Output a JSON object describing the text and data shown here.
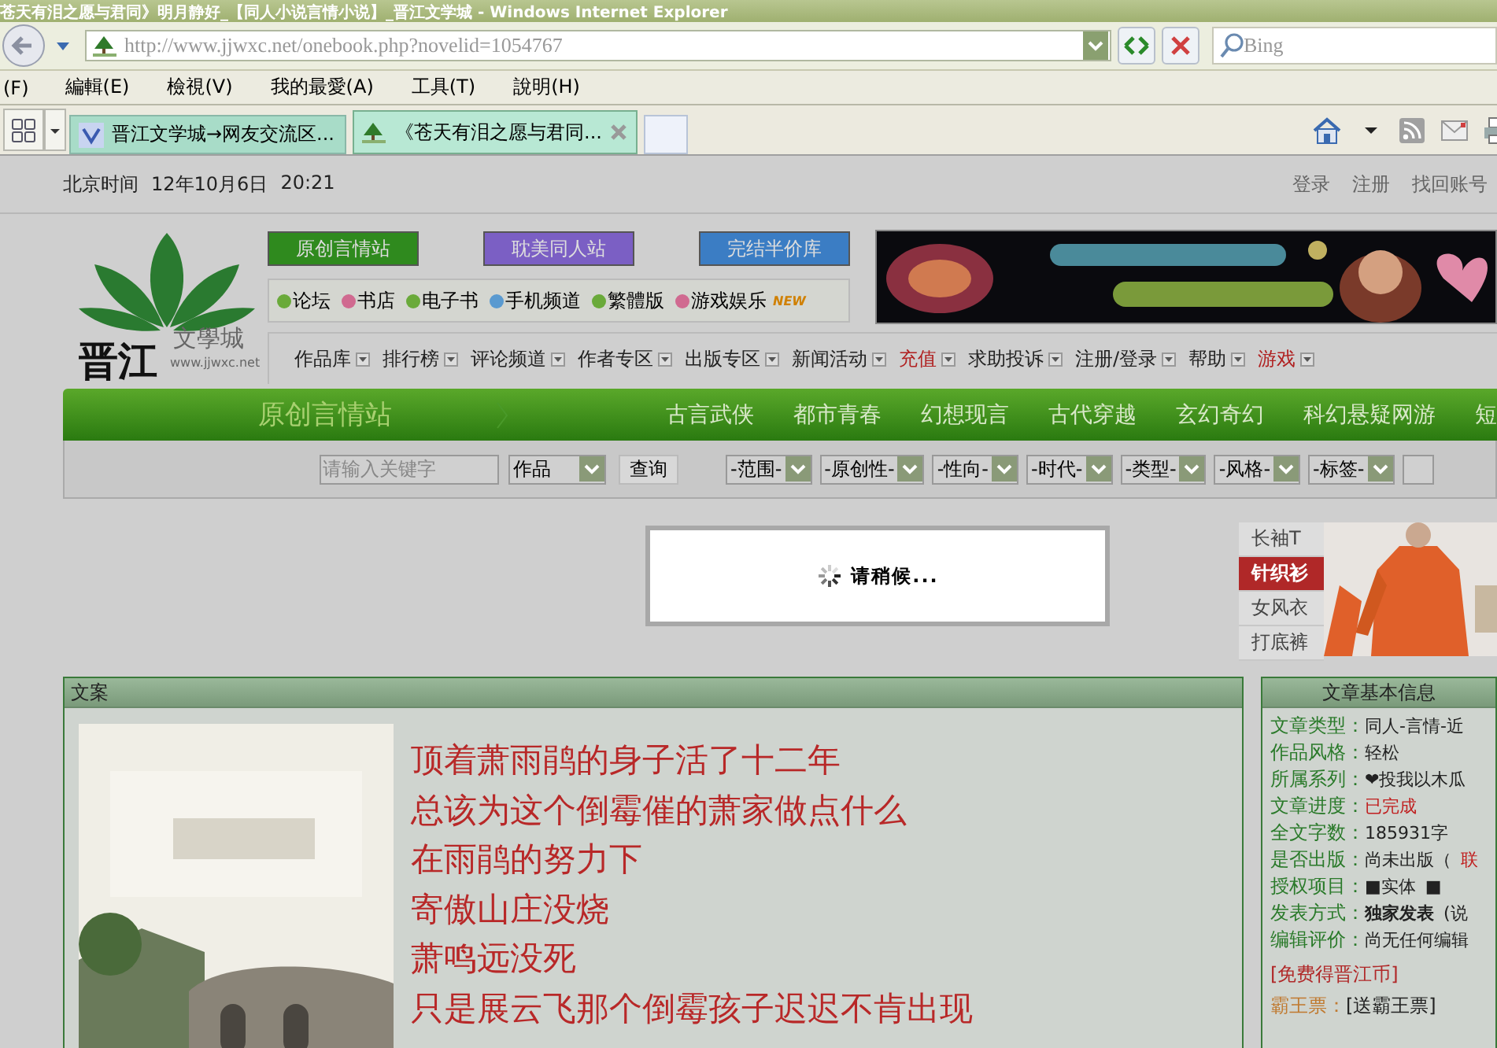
{
  "window": {
    "title": "苍天有泪之愿与君同》明月静好_【同人小说言情小说】_晋江文学城 - Windows Internet Explorer"
  },
  "address_bar": {
    "url": "http://www.jjwxc.net/onebook.php?novelid=1054767"
  },
  "search": {
    "placeholder": "Bing"
  },
  "menu": [
    "(F)",
    "編輯(E)",
    "檢視(V)",
    "我的最愛(A)",
    "工具(T)",
    "說明(H)"
  ],
  "tabs": [
    {
      "label": "晋江文学城→网友交流区...",
      "selected": false
    },
    {
      "label": "《苍天有泪之愿与君同...",
      "selected": true
    }
  ],
  "page": {
    "clock": {
      "label": "北京时间",
      "date": "12年10月6日",
      "time": "20:21"
    },
    "account_links": [
      "登录",
      "注册",
      "找回账号"
    ],
    "logo": {
      "name": "晋江",
      "subtitle": "文學城",
      "url": "www.jjwxc.net"
    },
    "site_buttons": [
      {
        "label": "原创言情站",
        "color": "#2f8a1e"
      },
      {
        "label": "耽美同人站",
        "color": "#7b5fc4"
      },
      {
        "label": "完结半价库",
        "color": "#3b7dc4"
      }
    ],
    "quick_links": [
      {
        "label": "论坛",
        "color": "#6aaa3a"
      },
      {
        "label": "书店",
        "color": "#d06a90"
      },
      {
        "label": "电子书",
        "color": "#6aaa3a"
      },
      {
        "label": "手机频道",
        "color": "#5a9ad0"
      },
      {
        "label": "繁體版",
        "color": "#6aaa3a"
      },
      {
        "label": "游戏娱乐",
        "color": "#d06a90",
        "badge": "NEW"
      }
    ],
    "nav": [
      {
        "label": "作品库",
        "highlight": false
      },
      {
        "label": "排行榜",
        "highlight": false
      },
      {
        "label": "评论频道",
        "highlight": false
      },
      {
        "label": "作者专区",
        "highlight": false
      },
      {
        "label": "出版专区",
        "highlight": false
      },
      {
        "label": "新闻活动",
        "highlight": false
      },
      {
        "label": "充值",
        "highlight": true
      },
      {
        "label": "求助投诉",
        "highlight": false
      },
      {
        "label": "注册/登录",
        "highlight": false
      },
      {
        "label": "帮助",
        "highlight": false
      },
      {
        "label": "游戏",
        "highlight": true
      }
    ],
    "channel": {
      "title": "原创言情站",
      "categories": [
        "古言武侠",
        "都市青春",
        "幻想现言",
        "古代穿越",
        "玄幻奇幻",
        "科幻悬疑网游",
        "短"
      ]
    },
    "filter": {
      "placeholder": "请输入关键字",
      "type": "作品",
      "button": "查询",
      "selects": [
        "-范围-",
        "-原创性-",
        "-性向-",
        "-时代-",
        "-类型-",
        "-风格-",
        "-标签-"
      ]
    },
    "loading": {
      "text": "请稍候..."
    },
    "ad": {
      "tags": [
        {
          "label": "长袖T",
          "selected": false
        },
        {
          "label": "针织衫",
          "selected": true
        },
        {
          "label": "女风衣",
          "selected": false
        },
        {
          "label": "打底裤",
          "selected": false
        }
      ]
    },
    "synopsis": {
      "title": "文案",
      "lines": [
        "顶着萧雨鹃的身子活了十二年",
        "总该为这个倒霉催的萧家做点什么",
        "在雨鹃的努力下",
        "寄傲山庄没烧",
        "萧鸣远没死",
        "只是展云飞那个倒霉孩子迟迟不肯出现"
      ]
    },
    "info": {
      "title": "文章基本信息",
      "rows": [
        {
          "label": "文章类型：",
          "value": "同人-言情-近",
          "alert": false,
          "bold": false
        },
        {
          "label": "作品风格：",
          "value": "轻松",
          "alert": false,
          "bold": false
        },
        {
          "label": "所属系列：",
          "value": "❤投我以木瓜",
          "alert": false,
          "bold": false
        },
        {
          "label": "文章进度：",
          "value": "已完成",
          "alert": true,
          "bold": false
        },
        {
          "label": "全文字数：",
          "value": "185931字",
          "alert": false,
          "bold": false
        },
        {
          "label": "是否出版：",
          "value": "尚未出版（",
          "alert": false,
          "bold": false,
          "extra": "联",
          "extra_alert": true
        },
        {
          "label": "授权项目：",
          "value": "■实体",
          "alert": false,
          "bold": false,
          "extra": "■",
          "extra_alert": false
        },
        {
          "label": "发表方式：",
          "value": "独家发表",
          "alert": false,
          "bold": true,
          "extra": "(说",
          "extra_alert": false
        },
        {
          "label": "编辑评价：",
          "value": "尚无任何编辑",
          "alert": false,
          "bold": false
        }
      ],
      "coin_link": "[免费得晋江币]",
      "vote": {
        "label": "霸王票：",
        "link": "[送霸王票]"
      }
    }
  }
}
